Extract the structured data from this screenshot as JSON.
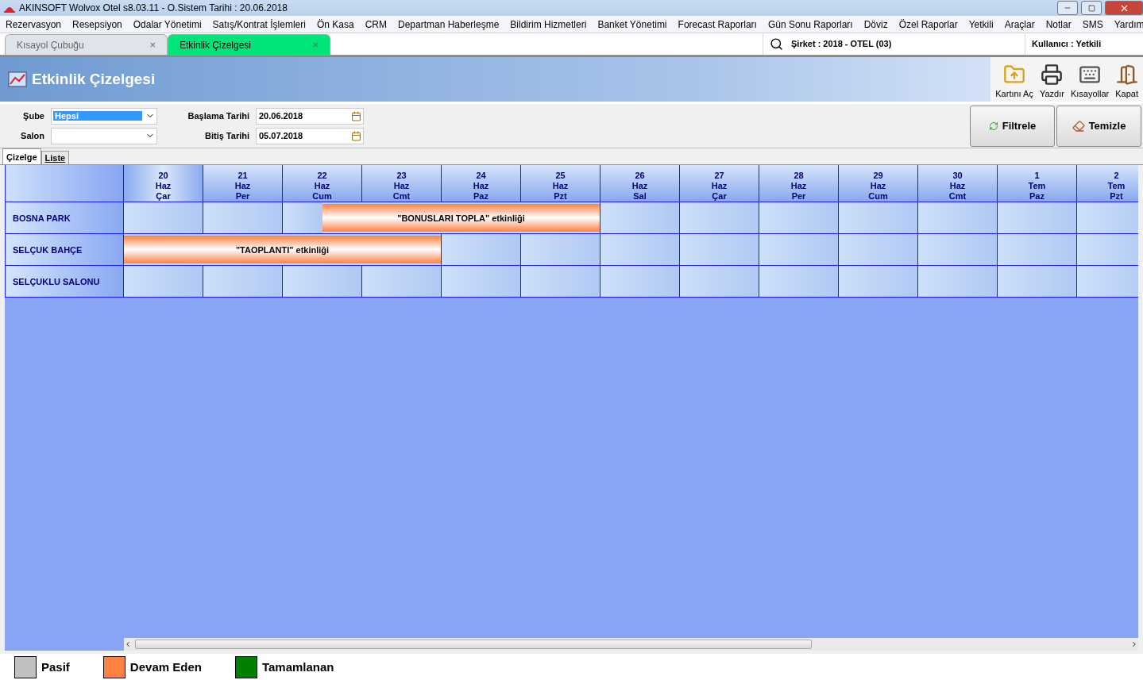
{
  "window": {
    "title": "AKINSOFT Wolvox Otel s8.03.11 - O.Sistem Tarihi : 20.06.2018"
  },
  "menu": [
    "Rezervasyon",
    "Resepsiyon",
    "Odalar Yönetimi",
    "Satış/Kontrat İşlemleri",
    "Ön Kasa",
    "CRM",
    "Departman Haberleşme",
    "Bildirim Hizmetleri",
    "Banket Yönetimi",
    "Forecast Raporları",
    "Gün Sonu Raporları",
    "Döviz",
    "Özel Raporlar",
    "Yetkili",
    "Araçlar",
    "Notlar",
    "SMS",
    "Yardım"
  ],
  "doc_tabs": [
    {
      "label": "Kısayol Çubuğu",
      "selected": false,
      "close": "×"
    },
    {
      "label": "Etkinlik Çizelgesi",
      "selected": true,
      "close": "×"
    }
  ],
  "company": "Şirket : 2018 - OTEL (03)",
  "user": "Kullanıcı : Yetkili",
  "header": {
    "title": "Etkinlik Çizelgesi"
  },
  "toolbar": [
    {
      "kind": "open",
      "label": "Kartını Aç"
    },
    {
      "kind": "print",
      "label": "Yazdır"
    },
    {
      "kind": "keyboard",
      "label": "Kısayollar"
    },
    {
      "kind": "close",
      "label": "Kapat"
    }
  ],
  "filters": {
    "branch_label": "Şube",
    "branch_value": "Hepsi",
    "hall_label": "Salon",
    "start_label": "Başlama Tarihi",
    "start_value": "20.06.2018",
    "end_label": "Bitiş Tarihi",
    "end_value": "05.07.2018"
  },
  "actions": [
    {
      "kind": "filter",
      "label": "Filtrele"
    },
    {
      "kind": "clear",
      "label": "Temizle"
    }
  ],
  "view_tabs": [
    {
      "label": "Çizelge",
      "selected": true
    },
    {
      "label": "Liste",
      "selected": false
    }
  ],
  "days": [
    {
      "day": "20",
      "month": "Haz",
      "weekday": "Çar",
      "selected": true
    },
    {
      "day": "21",
      "month": "Haz",
      "weekday": "Per",
      "selected": false
    },
    {
      "day": "22",
      "month": "Haz",
      "weekday": "Cum",
      "selected": false
    },
    {
      "day": "23",
      "month": "Haz",
      "weekday": "Cmt",
      "selected": false
    },
    {
      "day": "24",
      "month": "Haz",
      "weekday": "Paz",
      "selected": false
    },
    {
      "day": "25",
      "month": "Haz",
      "weekday": "Pzt",
      "selected": false
    },
    {
      "day": "26",
      "month": "Haz",
      "weekday": "Sal",
      "selected": false
    },
    {
      "day": "27",
      "month": "Haz",
      "weekday": "Çar",
      "selected": false
    },
    {
      "day": "28",
      "month": "Haz",
      "weekday": "Per",
      "selected": false
    },
    {
      "day": "29",
      "month": "Haz",
      "weekday": "Cum",
      "selected": false
    },
    {
      "day": "30",
      "month": "Haz",
      "weekday": "Cmt",
      "selected": false
    },
    {
      "day": "1",
      "month": "Tem",
      "weekday": "Paz",
      "selected": false
    },
    {
      "day": "2",
      "month": "Tem",
      "weekday": "Pzt",
      "selected": false
    }
  ],
  "halls": [
    {
      "name": "BOSNA PARK",
      "slots": [
        {
          "kind": "day"
        },
        {
          "kind": "day"
        },
        {
          "kind": "half"
        },
        {
          "kind": "event",
          "label": "\"BONUSLARI TOPLA\" etkinliği",
          "color": "#ff8040",
          "parts": [
            {
              "kind": "half"
            },
            {
              "kind": "day"
            },
            {
              "kind": "day"
            },
            {
              "kind": "day"
            }
          ]
        },
        {
          "kind": "day"
        },
        {
          "kind": "day"
        },
        {
          "kind": "day"
        },
        {
          "kind": "day"
        },
        {
          "kind": "day"
        },
        {
          "kind": "day"
        },
        {
          "kind": "day"
        }
      ]
    },
    {
      "name": "SELÇUK BAHÇE",
      "slots": [
        {
          "kind": "event",
          "label": "\"TAOPLANTI\" etkinliği",
          "color": "#ff8040",
          "parts": [
            {
              "kind": "day"
            },
            {
              "kind": "day"
            },
            {
              "kind": "day"
            },
            {
              "kind": "day"
            }
          ]
        },
        {
          "kind": "day"
        },
        {
          "kind": "day"
        },
        {
          "kind": "day"
        },
        {
          "kind": "day"
        },
        {
          "kind": "day"
        },
        {
          "kind": "day"
        },
        {
          "kind": "day"
        },
        {
          "kind": "day"
        },
        {
          "kind": "day"
        }
      ]
    },
    {
      "name": "SELÇUKLU SALONU",
      "slots": [
        {
          "kind": "day"
        },
        {
          "kind": "day"
        },
        {
          "kind": "day"
        },
        {
          "kind": "day"
        },
        {
          "kind": "day"
        },
        {
          "kind": "day"
        },
        {
          "kind": "day"
        },
        {
          "kind": "day"
        },
        {
          "kind": "day"
        },
        {
          "kind": "day"
        },
        {
          "kind": "day"
        },
        {
          "kind": "day"
        },
        {
          "kind": "day"
        }
      ]
    }
  ],
  "legend": [
    {
      "label": "Pasif",
      "color": "#c0c0c0"
    },
    {
      "label": "Devam Eden",
      "color": "#ff8040"
    },
    {
      "label": "Tamamlanan",
      "color": "#008000"
    }
  ]
}
